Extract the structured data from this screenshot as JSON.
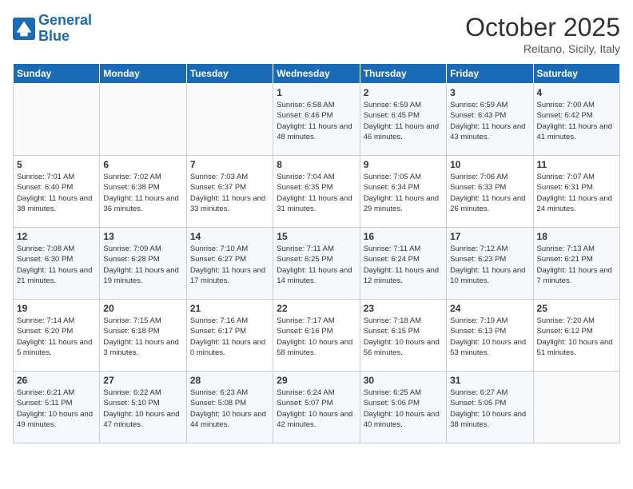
{
  "header": {
    "logo_line1": "General",
    "logo_line2": "Blue",
    "month": "October 2025",
    "location": "Reitano, Sicily, Italy"
  },
  "days_of_week": [
    "Sunday",
    "Monday",
    "Tuesday",
    "Wednesday",
    "Thursday",
    "Friday",
    "Saturday"
  ],
  "weeks": [
    [
      {
        "day": "",
        "text": ""
      },
      {
        "day": "",
        "text": ""
      },
      {
        "day": "",
        "text": ""
      },
      {
        "day": "1",
        "text": "Sunrise: 6:58 AM\nSunset: 6:46 PM\nDaylight: 11 hours and 48 minutes."
      },
      {
        "day": "2",
        "text": "Sunrise: 6:59 AM\nSunset: 6:45 PM\nDaylight: 11 hours and 46 minutes."
      },
      {
        "day": "3",
        "text": "Sunrise: 6:59 AM\nSunset: 6:43 PM\nDaylight: 11 hours and 43 minutes."
      },
      {
        "day": "4",
        "text": "Sunrise: 7:00 AM\nSunset: 6:42 PM\nDaylight: 11 hours and 41 minutes."
      }
    ],
    [
      {
        "day": "5",
        "text": "Sunrise: 7:01 AM\nSunset: 6:40 PM\nDaylight: 11 hours and 38 minutes."
      },
      {
        "day": "6",
        "text": "Sunrise: 7:02 AM\nSunset: 6:38 PM\nDaylight: 11 hours and 36 minutes."
      },
      {
        "day": "7",
        "text": "Sunrise: 7:03 AM\nSunset: 6:37 PM\nDaylight: 11 hours and 33 minutes."
      },
      {
        "day": "8",
        "text": "Sunrise: 7:04 AM\nSunset: 6:35 PM\nDaylight: 11 hours and 31 minutes."
      },
      {
        "day": "9",
        "text": "Sunrise: 7:05 AM\nSunset: 6:34 PM\nDaylight: 11 hours and 29 minutes."
      },
      {
        "day": "10",
        "text": "Sunrise: 7:06 AM\nSunset: 6:33 PM\nDaylight: 11 hours and 26 minutes."
      },
      {
        "day": "11",
        "text": "Sunrise: 7:07 AM\nSunset: 6:31 PM\nDaylight: 11 hours and 24 minutes."
      }
    ],
    [
      {
        "day": "12",
        "text": "Sunrise: 7:08 AM\nSunset: 6:30 PM\nDaylight: 11 hours and 21 minutes."
      },
      {
        "day": "13",
        "text": "Sunrise: 7:09 AM\nSunset: 6:28 PM\nDaylight: 11 hours and 19 minutes."
      },
      {
        "day": "14",
        "text": "Sunrise: 7:10 AM\nSunset: 6:27 PM\nDaylight: 11 hours and 17 minutes."
      },
      {
        "day": "15",
        "text": "Sunrise: 7:11 AM\nSunset: 6:25 PM\nDaylight: 11 hours and 14 minutes."
      },
      {
        "day": "16",
        "text": "Sunrise: 7:11 AM\nSunset: 6:24 PM\nDaylight: 11 hours and 12 minutes."
      },
      {
        "day": "17",
        "text": "Sunrise: 7:12 AM\nSunset: 6:23 PM\nDaylight: 11 hours and 10 minutes."
      },
      {
        "day": "18",
        "text": "Sunrise: 7:13 AM\nSunset: 6:21 PM\nDaylight: 11 hours and 7 minutes."
      }
    ],
    [
      {
        "day": "19",
        "text": "Sunrise: 7:14 AM\nSunset: 6:20 PM\nDaylight: 11 hours and 5 minutes."
      },
      {
        "day": "20",
        "text": "Sunrise: 7:15 AM\nSunset: 6:18 PM\nDaylight: 11 hours and 3 minutes."
      },
      {
        "day": "21",
        "text": "Sunrise: 7:16 AM\nSunset: 6:17 PM\nDaylight: 11 hours and 0 minutes."
      },
      {
        "day": "22",
        "text": "Sunrise: 7:17 AM\nSunset: 6:16 PM\nDaylight: 10 hours and 58 minutes."
      },
      {
        "day": "23",
        "text": "Sunrise: 7:18 AM\nSunset: 6:15 PM\nDaylight: 10 hours and 56 minutes."
      },
      {
        "day": "24",
        "text": "Sunrise: 7:19 AM\nSunset: 6:13 PM\nDaylight: 10 hours and 53 minutes."
      },
      {
        "day": "25",
        "text": "Sunrise: 7:20 AM\nSunset: 6:12 PM\nDaylight: 10 hours and 51 minutes."
      }
    ],
    [
      {
        "day": "26",
        "text": "Sunrise: 6:21 AM\nSunset: 5:11 PM\nDaylight: 10 hours and 49 minutes."
      },
      {
        "day": "27",
        "text": "Sunrise: 6:22 AM\nSunset: 5:10 PM\nDaylight: 10 hours and 47 minutes."
      },
      {
        "day": "28",
        "text": "Sunrise: 6:23 AM\nSunset: 5:08 PM\nDaylight: 10 hours and 44 minutes."
      },
      {
        "day": "29",
        "text": "Sunrise: 6:24 AM\nSunset: 5:07 PM\nDaylight: 10 hours and 42 minutes."
      },
      {
        "day": "30",
        "text": "Sunrise: 6:25 AM\nSunset: 5:06 PM\nDaylight: 10 hours and 40 minutes."
      },
      {
        "day": "31",
        "text": "Sunrise: 6:27 AM\nSunset: 5:05 PM\nDaylight: 10 hours and 38 minutes."
      },
      {
        "day": "",
        "text": ""
      }
    ]
  ]
}
